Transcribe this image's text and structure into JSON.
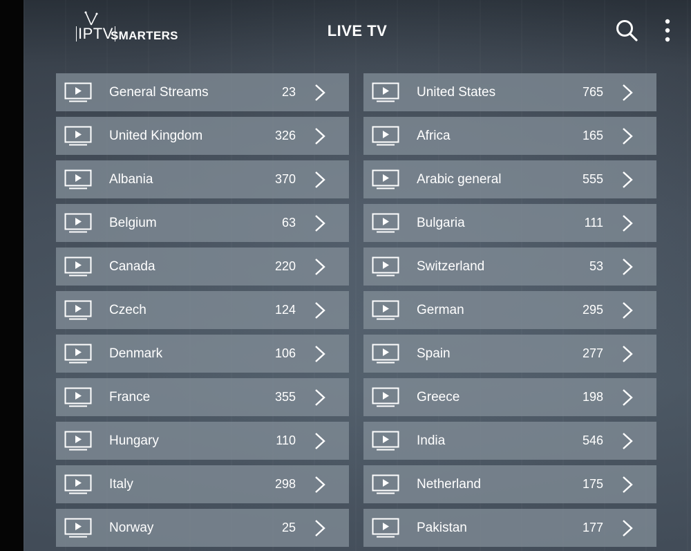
{
  "header": {
    "logo_iptv": "IPTV",
    "logo_smarters": "SMARTERS",
    "title": "LIVE TV"
  },
  "categories": [
    {
      "name": "General Streams",
      "count": "23"
    },
    {
      "name": "United States",
      "count": "765"
    },
    {
      "name": "United Kingdom",
      "count": "326"
    },
    {
      "name": "Africa",
      "count": "165"
    },
    {
      "name": "Albania",
      "count": "370"
    },
    {
      "name": "Arabic general",
      "count": "555"
    },
    {
      "name": "Belgium",
      "count": "63"
    },
    {
      "name": "Bulgaria",
      "count": "111"
    },
    {
      "name": "Canada",
      "count": "220"
    },
    {
      "name": "Switzerland",
      "count": "53"
    },
    {
      "name": "Czech",
      "count": "124"
    },
    {
      "name": "German",
      "count": "295"
    },
    {
      "name": "Denmark",
      "count": "106"
    },
    {
      "name": "Spain",
      "count": "277"
    },
    {
      "name": "France",
      "count": "355"
    },
    {
      "name": "Greece",
      "count": "198"
    },
    {
      "name": "Hungary",
      "count": "110"
    },
    {
      "name": "India",
      "count": "546"
    },
    {
      "name": "Italy",
      "count": "298"
    },
    {
      "name": "Netherland",
      "count": "175"
    },
    {
      "name": "Norway",
      "count": "25"
    },
    {
      "name": "Pakistan",
      "count": "177"
    }
  ],
  "icons": {
    "item": "tv-play-icon",
    "chevron": "chevron-right-icon",
    "search": "search-icon",
    "more": "more-vertical-icon"
  }
}
